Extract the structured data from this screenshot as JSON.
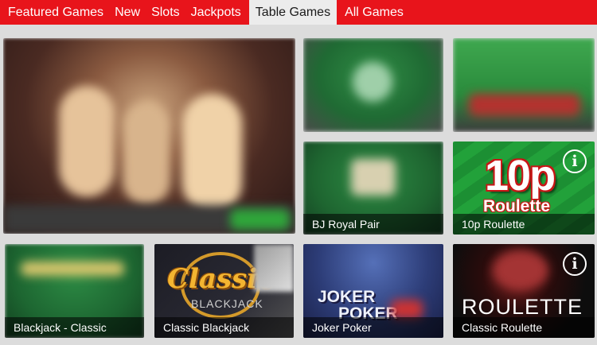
{
  "nav": {
    "tabs": [
      {
        "label": "Featured Games"
      },
      {
        "label": "New"
      },
      {
        "label": "Slots"
      },
      {
        "label": "Jackpots"
      },
      {
        "label": "Table Games"
      },
      {
        "label": "All Games"
      }
    ],
    "active_tab": "Table Games"
  },
  "tiles": {
    "bj_royal_pair": {
      "label": "BJ Royal Pair"
    },
    "tenp_roulette": {
      "label": "10p Roulette",
      "logo_top": "10p",
      "logo_bottom": "Roulette"
    },
    "blackjack_classic": {
      "label": "Blackjack - Classic"
    },
    "classic_blackjack": {
      "label": "Classic Blackjack",
      "logo_top": "Classic",
      "logo_bottom": "BLACKJACK"
    },
    "joker_poker": {
      "label": "Joker Poker",
      "logo_top": "JOKER",
      "logo_bottom": "POKER"
    },
    "classic_roulette": {
      "label": "Classic Roulette",
      "logo": "ROULETTE"
    }
  },
  "colors": {
    "brand_red": "#e8141b",
    "tab_active_bg": "#ececec",
    "page_bg": "#dcdcdc",
    "felt_green": "#1f7a3a"
  }
}
